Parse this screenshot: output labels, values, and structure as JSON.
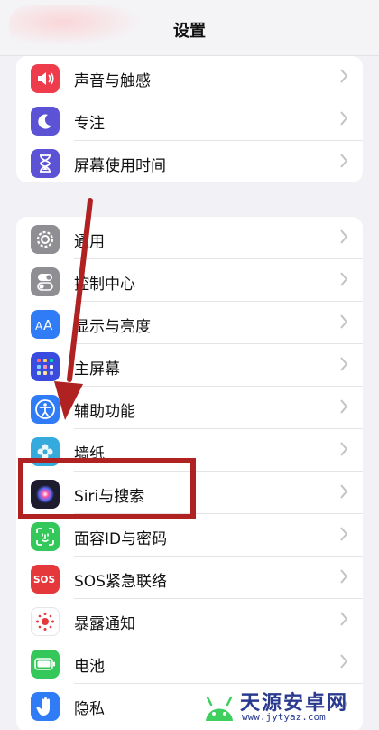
{
  "header": {
    "title": "设置"
  },
  "groups": [
    {
      "items": [
        {
          "label": "声音与触感",
          "icon": "speaker-icon",
          "color": "#ee3c4d"
        },
        {
          "label": "专注",
          "icon": "moon-icon",
          "color": "#5b52d6"
        },
        {
          "label": "屏幕使用时间",
          "icon": "hourglass-icon",
          "color": "#5b52d6"
        }
      ]
    },
    {
      "items": [
        {
          "label": "通用",
          "icon": "gear-icon",
          "color": "#8e8e93"
        },
        {
          "label": "控制中心",
          "icon": "toggles-icon",
          "color": "#8e8e93"
        },
        {
          "label": "显示与亮度",
          "icon": "text-size-icon",
          "color": "#2f7cf6"
        },
        {
          "label": "主屏幕",
          "icon": "home-grid-icon",
          "color": "#3a4be0"
        },
        {
          "label": "辅助功能",
          "icon": "accessibility-icon",
          "color": "#2f7cf6"
        },
        {
          "label": "墙纸",
          "icon": "flower-icon",
          "color": "#35aadc"
        },
        {
          "label": "Siri与搜索",
          "icon": "siri-icon",
          "color": "#1c1c2e"
        },
        {
          "label": "面容ID与密码",
          "icon": "face-id-icon",
          "color": "#34c759"
        },
        {
          "label": "SOS紧急联络",
          "icon": "sos-icon",
          "color": "#e5383b"
        },
        {
          "label": "暴露通知",
          "icon": "exposure-icon",
          "color": "#ffffff"
        },
        {
          "label": "电池",
          "icon": "battery-icon",
          "color": "#34c759"
        },
        {
          "label": "隐私",
          "icon": "hand-icon",
          "color": "#2f7cf6"
        }
      ]
    }
  ],
  "watermark": {
    "name": "天源安卓网",
    "url": "www.jytyaz.com"
  },
  "accents": {
    "highlight": "#b02222"
  }
}
